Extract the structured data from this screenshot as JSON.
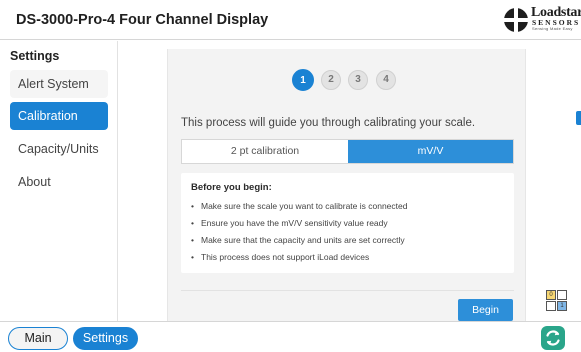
{
  "window": {
    "title": "DS-3000-Pro-4 Four Channel Display"
  },
  "logo": {
    "word": "Loadstar",
    "sub": "SENSORS",
    "tagline": "Sensing Made Easy"
  },
  "sidebar": {
    "heading": "Settings",
    "items": [
      {
        "label": "Alert System",
        "active": false
      },
      {
        "label": "Calibration",
        "active": true
      },
      {
        "label": "Capacity/Units",
        "active": false
      },
      {
        "label": "About",
        "active": false
      }
    ]
  },
  "wizard": {
    "steps": [
      "1",
      "2",
      "3",
      "4"
    ],
    "current_step": "1",
    "intro": "This process will guide you through calibrating your scale.",
    "modes": [
      {
        "label": "2 pt calibration",
        "selected": false
      },
      {
        "label": "mV/V",
        "selected": true
      }
    ],
    "info_title": "Before you begin:",
    "bullets": [
      "Make sure the scale you want to calibrate is connected",
      "Ensure you have the mV/V sensitivity value ready",
      "Make sure that the capacity and units are set correctly",
      "This process does not support iLoad devices"
    ],
    "bullet_char": "•",
    "begin_label": "Begin"
  },
  "bottom": {
    "tabs": [
      {
        "label": "Main",
        "active": false
      },
      {
        "label": "Settings",
        "active": true
      }
    ]
  },
  "layout_icon": {
    "cells": [
      "0",
      "",
      "",
      "1"
    ]
  },
  "colors": {
    "accent": "#1a82d3",
    "button": "#2d8fd9",
    "refresh": "#2aa58a",
    "panel": "#f3f3f3"
  },
  "icons": {
    "logo": "loadstar-logo-icon",
    "layout": "channel-layout-icon",
    "refresh": "refresh-icon"
  }
}
